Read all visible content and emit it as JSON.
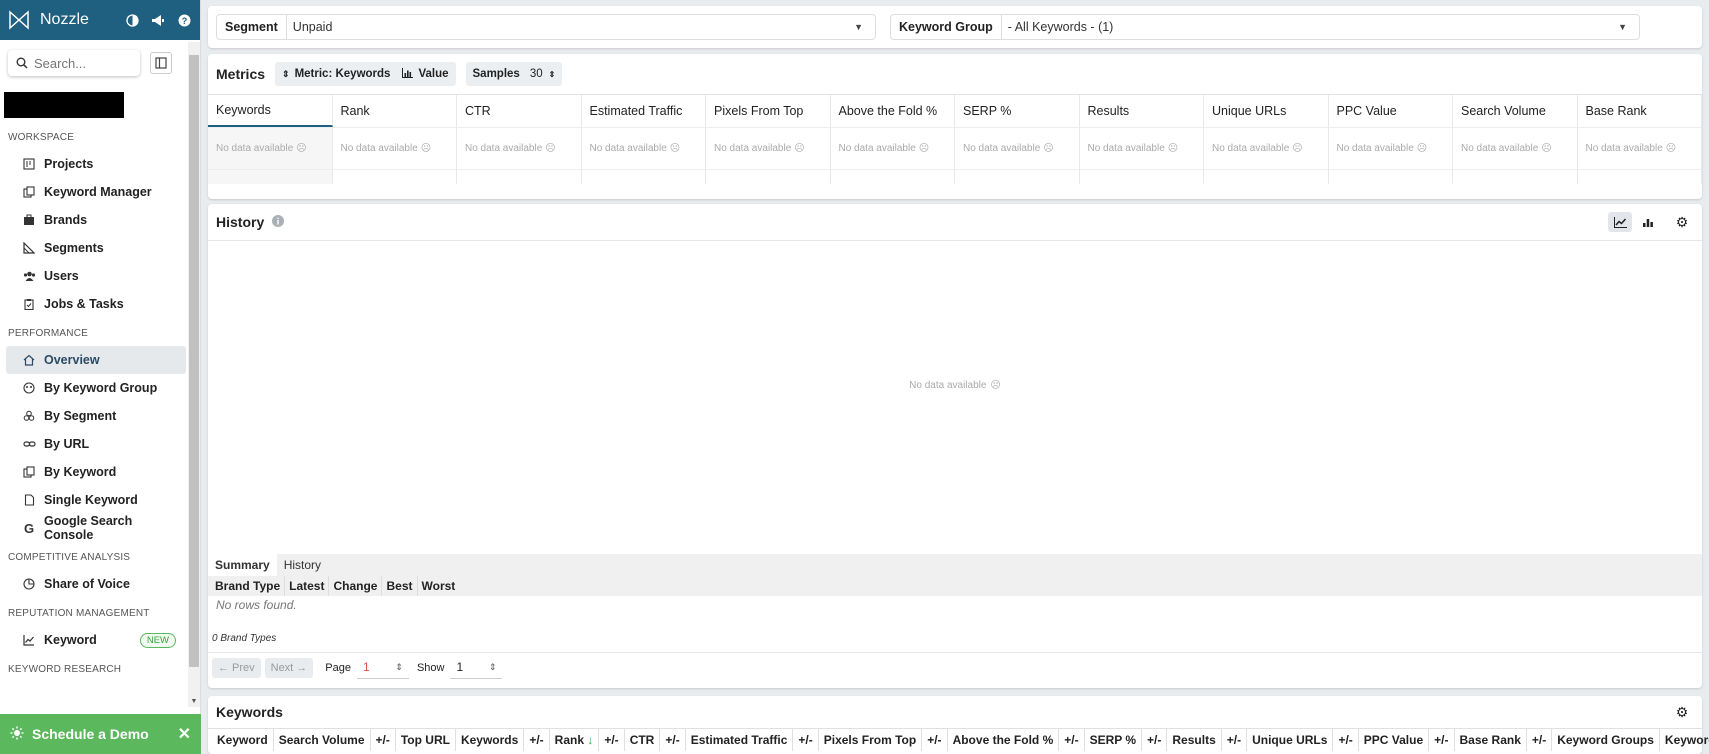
{
  "app": {
    "name": "Nozzle"
  },
  "sidebar": {
    "search_placeholder": "Search...",
    "sections": [
      {
        "title": "WORKSPACE",
        "items": [
          {
            "label": "Projects",
            "icon": "projects-icon"
          },
          {
            "label": "Keyword Manager",
            "icon": "keyword-manager-icon"
          },
          {
            "label": "Brands",
            "icon": "briefcase-icon"
          },
          {
            "label": "Segments",
            "icon": "segments-icon"
          },
          {
            "label": "Users",
            "icon": "users-icon"
          },
          {
            "label": "Jobs & Tasks",
            "icon": "clipboard-icon"
          }
        ]
      },
      {
        "title": "PERFORMANCE",
        "items": [
          {
            "label": "Overview",
            "icon": "home-icon",
            "active": true
          },
          {
            "label": "By Keyword Group",
            "icon": "keyword-group-icon"
          },
          {
            "label": "By Segment",
            "icon": "segment-icon"
          },
          {
            "label": "By URL",
            "icon": "link-icon"
          },
          {
            "label": "By Keyword",
            "icon": "keyword-icon"
          },
          {
            "label": "Single Keyword",
            "icon": "document-icon"
          },
          {
            "label": "Google Search Console",
            "icon": "google-icon"
          }
        ]
      },
      {
        "title": "COMPETITIVE ANALYSIS",
        "items": [
          {
            "label": "Share of Voice",
            "icon": "pie-chart-icon"
          }
        ]
      },
      {
        "title": "REPUTATION MANAGEMENT",
        "items": [
          {
            "label": "Keyword",
            "icon": "line-chart-icon",
            "badge": "NEW"
          }
        ]
      },
      {
        "title": "KEYWORD RESEARCH",
        "items": []
      }
    ],
    "demo_label": "Schedule a Demo"
  },
  "filters": {
    "segment_label": "Segment",
    "segment_value": "Unpaid",
    "keyword_group_label": "Keyword Group",
    "keyword_group_value": "- All Keywords - (1)"
  },
  "metrics": {
    "title": "Metrics",
    "metric_pill": "Metric: Keywords",
    "value_pill": "Value",
    "samples_label": "Samples",
    "samples_value": "30",
    "columns": [
      "Keywords",
      "Rank",
      "CTR",
      "Estimated Traffic",
      "Pixels From Top",
      "Above the Fold %",
      "SERP %",
      "Results",
      "Unique URLs",
      "PPC Value",
      "Search Volume",
      "Base Rank"
    ],
    "empty_text": "No data available"
  },
  "history": {
    "title": "History",
    "empty_text": "No data available",
    "tabs": [
      "Summary",
      "History"
    ],
    "summary_columns": [
      "Brand Type",
      "Latest",
      "Change",
      "Best",
      "Worst"
    ],
    "no_rows": "No rows found.",
    "count_text": "0 Brand Types",
    "prev_label": "Prev",
    "next_label": "Next",
    "page_label": "Page",
    "page_value": "1",
    "show_label": "Show",
    "show_value": "1"
  },
  "keywords": {
    "title": "Keywords",
    "columns": [
      "Keyword",
      "Search Volume",
      "+/-",
      "Top URL",
      "Keywords",
      "+/-",
      "Rank",
      "+/-",
      "CTR",
      "+/-",
      "Estimated Traffic",
      "+/-",
      "Pixels From Top",
      "+/-",
      "Above the Fold %",
      "+/-",
      "SERP %",
      "+/-",
      "Results",
      "+/-",
      "Unique URLs",
      "+/-",
      "PPC Value",
      "+/-",
      "Base Rank",
      "+/-",
      "Keyword Groups",
      "Keyword ID"
    ],
    "sorted_column": "Rank"
  }
}
